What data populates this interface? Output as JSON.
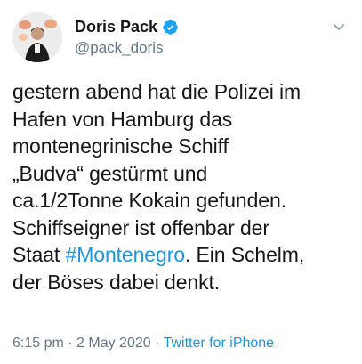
{
  "author": {
    "display_name": "Doris Pack",
    "handle": "@pack_doris",
    "verified": true
  },
  "tweet": {
    "lines": [
      "gestern abend hat die Polizei im",
      "Hafen von Hamburg das",
      "montenegrinische Schiff",
      "„Budva“ gestürmt und",
      "ca.1/2Tonne Kokain gefunden.",
      "Schiffseigner ist offenbar  der",
      "Staat ",
      "#Montenegro",
      ". Ein Schelm,",
      "der Böses dabei denkt."
    ]
  },
  "meta": {
    "time": "6:15 pm",
    "separator1": " · ",
    "date": "2 May 2020",
    "separator2": " · ",
    "source": "Twitter for iPhone"
  },
  "colors": {
    "link": "#1b95e0",
    "muted": "#657786",
    "text": "#14171a",
    "verified": "#1da1f2"
  },
  "icons": {
    "verified": "verified-badge-icon",
    "menu": "chevron-down-icon"
  }
}
